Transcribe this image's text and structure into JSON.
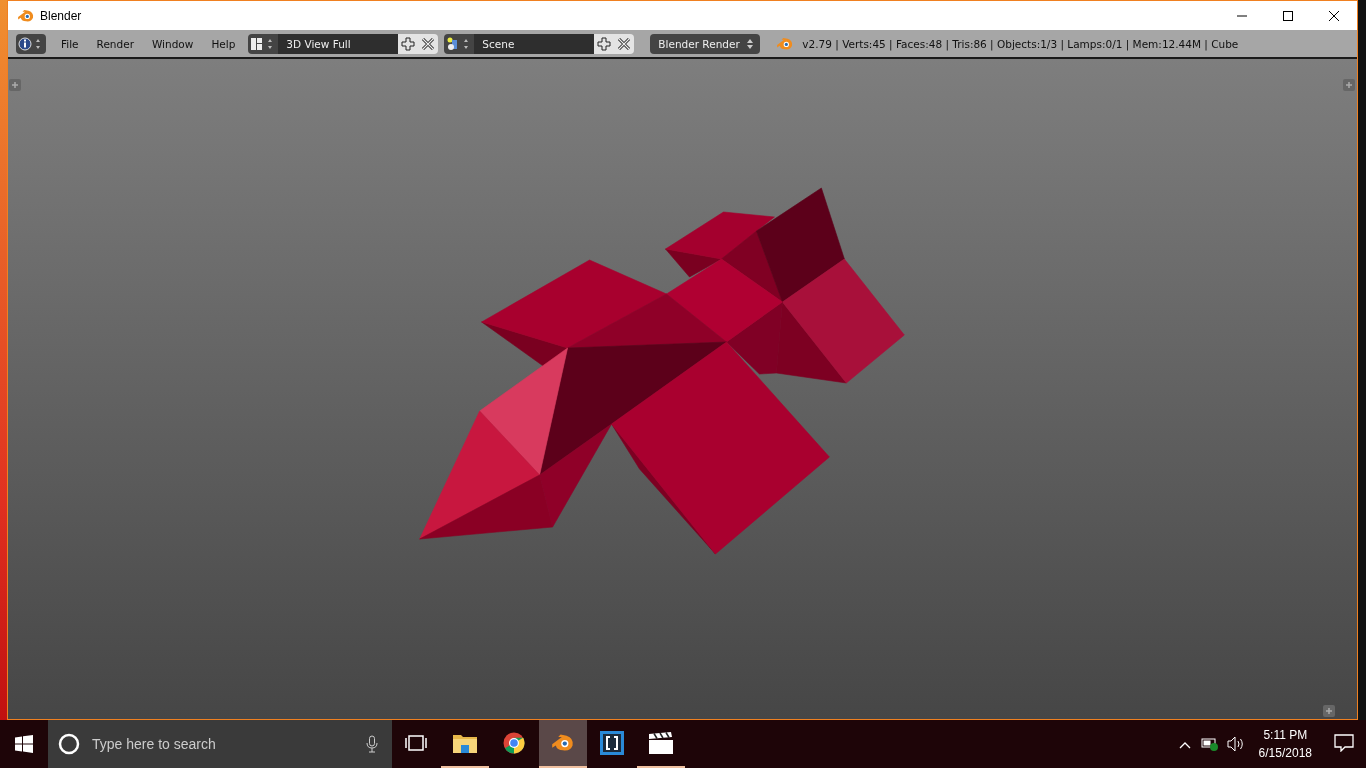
{
  "window": {
    "title": "Blender"
  },
  "header": {
    "menu": [
      {
        "label": "File"
      },
      {
        "label": "Render"
      },
      {
        "label": "Window"
      },
      {
        "label": "Help"
      }
    ],
    "screen_layout": {
      "value": "3D View Full"
    },
    "scene": {
      "value": "Scene"
    },
    "render_engine": {
      "value": "Blender Render"
    },
    "stats": "v2.79 | Verts:45 | Faces:48 | Tris:86 | Objects:1/3 | Lamps:0/1 | Mem:12.44M | Cube"
  },
  "taskbar": {
    "search": {
      "placeholder": "Type here to search"
    },
    "apps": [
      {
        "kind": "task-view",
        "running": false,
        "selected": false
      },
      {
        "kind": "folder",
        "running": true,
        "selected": false
      },
      {
        "kind": "chrome",
        "running": false,
        "selected": false
      },
      {
        "kind": "blender",
        "running": true,
        "selected": true
      },
      {
        "kind": "brackets",
        "running": false,
        "selected": false
      },
      {
        "kind": "clapper",
        "running": true,
        "selected": false
      }
    ],
    "clock": {
      "time": "5:11 PM",
      "date": "6/15/2018"
    }
  }
}
